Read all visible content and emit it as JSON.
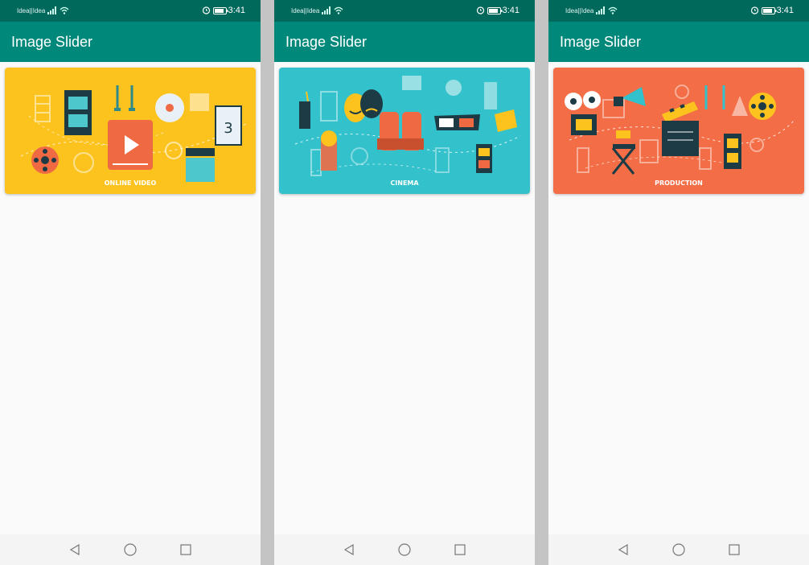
{
  "colors": {
    "status_bar": "#00695c",
    "app_bar": "#00897b",
    "slide_online_video_bg": "#fcc31e",
    "slide_cinema_bg": "#33c1cb",
    "slide_production_bg": "#f36d46"
  },
  "phones": [
    {
      "status": {
        "carrier": "Idea||Idea",
        "time": "3:41"
      },
      "app_title": "Image Slider",
      "slide": {
        "caption": "ONLINE VIDEO",
        "theme": "online-video-illustration"
      },
      "nav": [
        "back-icon",
        "home-icon",
        "recents-icon"
      ]
    },
    {
      "status": {
        "carrier": "Idea||Idea",
        "time": "3:41"
      },
      "app_title": "Image Slider",
      "slide": {
        "caption": "CINEMA",
        "theme": "cinema-illustration"
      },
      "nav": [
        "back-icon",
        "home-icon",
        "recents-icon"
      ]
    },
    {
      "status": {
        "carrier": "Idea||Idea",
        "time": "3:41"
      },
      "app_title": "Image Slider",
      "slide": {
        "caption": "PRODUCTION",
        "theme": "production-illustration"
      },
      "nav": [
        "back-icon",
        "home-icon",
        "recents-icon"
      ]
    }
  ]
}
